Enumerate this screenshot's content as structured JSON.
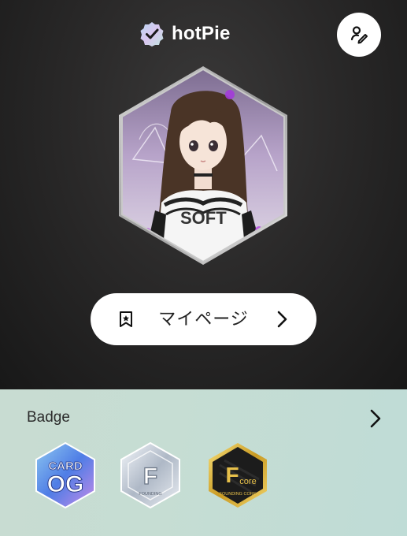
{
  "header": {
    "brand_name": "hotPie",
    "logo_icon": "verified-check-icon",
    "edit_icon": "edit-pen-icon"
  },
  "profile": {
    "avatar": "anime-girl-portrait"
  },
  "mypage_button": {
    "label": "マイページ",
    "icon": "bookmark-star-icon",
    "chevron": "chevron-right-icon"
  },
  "badges": {
    "title": "Badge",
    "items": [
      {
        "line1": "CARD",
        "line2": "OG"
      },
      {
        "letter": "F",
        "caption": "FOUNDING"
      },
      {
        "letter": "F",
        "suffix": "core",
        "caption": "FOUNDING CORE"
      }
    ]
  },
  "colors": {
    "top_bg": "#2a2929",
    "bottom_bg": "#c6ddd3",
    "button_bg": "#ffffff"
  }
}
